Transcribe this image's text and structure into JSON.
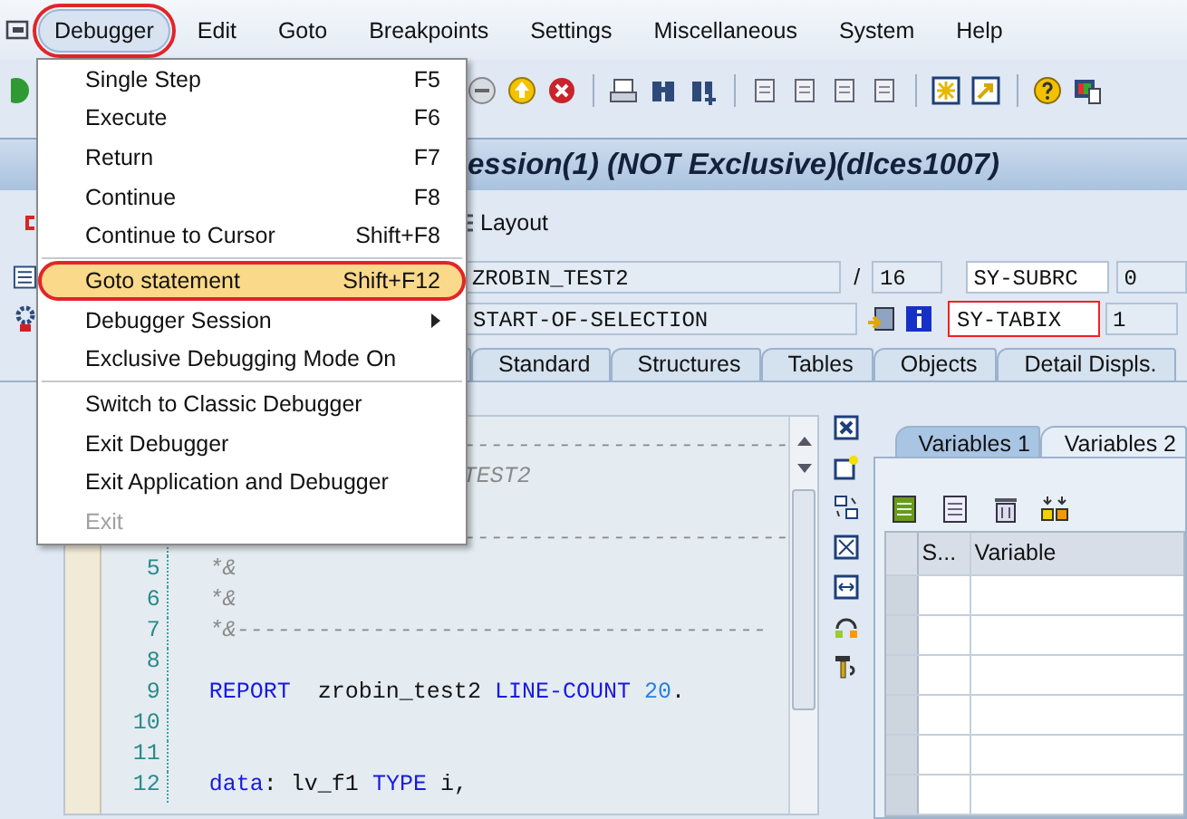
{
  "menu_bar": [
    {
      "label": "Debugger",
      "open": true,
      "circled": true
    },
    {
      "label": "Edit",
      "open": false,
      "circled": false
    },
    {
      "label": "Goto",
      "open": false,
      "circled": false
    },
    {
      "label": "Breakpoints",
      "open": false,
      "circled": false
    },
    {
      "label": "Settings",
      "open": false,
      "circled": false
    },
    {
      "label": "Miscellaneous",
      "open": false,
      "circled": false
    },
    {
      "label": "System",
      "open": false,
      "circled": false
    },
    {
      "label": "Help",
      "open": false,
      "circled": false
    }
  ],
  "dropdown": [
    {
      "kind": "item",
      "label": "Single Step",
      "shortcut": "F5",
      "selected": false,
      "disabled": false,
      "submenu": false,
      "circled": false
    },
    {
      "kind": "item",
      "label": "Execute",
      "shortcut": "F6",
      "selected": false,
      "disabled": false,
      "submenu": false,
      "circled": false
    },
    {
      "kind": "item",
      "label": "Return",
      "shortcut": "F7",
      "selected": false,
      "disabled": false,
      "submenu": false,
      "circled": false
    },
    {
      "kind": "item",
      "label": "Continue",
      "shortcut": "F8",
      "selected": false,
      "disabled": false,
      "submenu": false,
      "circled": false
    },
    {
      "kind": "item",
      "label": "Continue to Cursor",
      "shortcut": "Shift+F8",
      "selected": false,
      "disabled": false,
      "submenu": false,
      "circled": false
    },
    {
      "kind": "separator"
    },
    {
      "kind": "item",
      "label": "Goto statement",
      "shortcut": "Shift+F12",
      "selected": true,
      "disabled": false,
      "submenu": false,
      "circled": true
    },
    {
      "kind": "item",
      "label": "Debugger Session",
      "selected": false,
      "disabled": false,
      "submenu": true,
      "circled": false
    },
    {
      "kind": "item",
      "label": "Exclusive Debugging Mode On",
      "selected": false,
      "disabled": false,
      "submenu": false,
      "circled": false
    },
    {
      "kind": "separator"
    },
    {
      "kind": "item",
      "label": "Switch to Classic Debugger",
      "selected": false,
      "disabled": false,
      "submenu": false,
      "circled": false
    },
    {
      "kind": "item",
      "label": "Exit Debugger",
      "selected": false,
      "disabled": false,
      "submenu": false,
      "circled": false
    },
    {
      "kind": "item",
      "label": "Exit Application and Debugger",
      "selected": false,
      "disabled": false,
      "submenu": false,
      "circled": false
    },
    {
      "kind": "item",
      "label": "Exit",
      "selected": false,
      "disabled": true,
      "submenu": false,
      "circled": false
    }
  ],
  "title": "ession(1)  (NOT Exclusive)(dlces1007)",
  "app_toolbar": {
    "layout_button": "Layout"
  },
  "fields": [
    {
      "value": "ZROBIN_TEST2",
      "separator": "/",
      "line": "16",
      "sysfield": "SY-SUBRC",
      "sysvalue": "0",
      "marked": false
    },
    {
      "value": "START-OF-SELECTION",
      "sysfield": "SY-TABIX",
      "sysvalue": "1",
      "marked": true
    }
  ],
  "tabs": [
    {
      "label": "Standard",
      "selected": false
    },
    {
      "label": "Structures",
      "selected": false
    },
    {
      "label": "Tables",
      "selected": false
    },
    {
      "label": "Objects",
      "selected": false
    },
    {
      "label": "Detail Displs.",
      "selected": false
    }
  ],
  "code": [
    {
      "kind": "covered",
      "tokens": [
        {
          "kind": "comment",
          "text": "------------------------"
        }
      ]
    },
    {
      "kind": "covered",
      "tokens": [
        {
          "kind": "comment",
          "text": "TEST2"
        }
      ]
    },
    {
      "kind": "covered"
    },
    {
      "kind": "covered",
      "tokens": [
        {
          "kind": "comment",
          "text": "------------------------"
        }
      ]
    },
    {
      "num": "5",
      "tokens": [
        {
          "kind": "comment",
          "text": "*&"
        }
      ]
    },
    {
      "num": "6",
      "tokens": [
        {
          "kind": "comment",
          "text": "*&"
        }
      ]
    },
    {
      "num": "7",
      "tokens": [
        {
          "kind": "comment",
          "text": "*&---------------------------------------"
        }
      ]
    },
    {
      "num": "8"
    },
    {
      "num": "9",
      "tokens": [
        {
          "kind": "keyword",
          "text": "REPORT"
        },
        {
          "kind": "text",
          "text": "  zrobin_test2 "
        },
        {
          "kind": "keyword",
          "text": "LINE-COUNT"
        },
        {
          "kind": "number",
          "text": " 20"
        },
        {
          "kind": "text",
          "text": "."
        }
      ]
    },
    {
      "num": "10"
    },
    {
      "num": "11"
    },
    {
      "num": "12",
      "tokens": [
        {
          "kind": "keyword",
          "text": "data"
        },
        {
          "kind": "text",
          "text": ": lv_f1 "
        },
        {
          "kind": "keyword",
          "text": "TYPE"
        },
        {
          "kind": "text",
          "text": " i,"
        }
      ]
    }
  ],
  "variables": {
    "tabs": [
      {
        "label": "Variables 1",
        "selected": true
      },
      {
        "label": "Variables 2",
        "selected": false
      }
    ],
    "columns": [
      "S...",
      "Variable"
    ]
  }
}
